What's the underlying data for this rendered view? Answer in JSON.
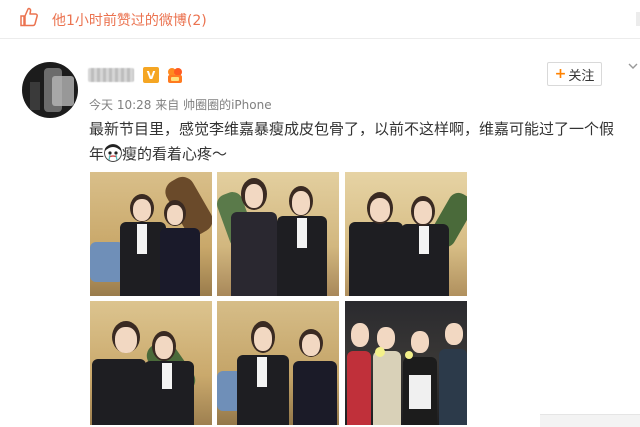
{
  "topbar": {
    "icon": "thumbs-up-icon",
    "text": "他1小时前赞过的微博(2)"
  },
  "post": {
    "avatar": "user-avatar",
    "vip_badge": "V",
    "follow_button": {
      "plus": "+",
      "label": "关注"
    },
    "meta": {
      "time": "今天 10:28",
      "source_prefix": "来自",
      "source": "帅圈圈的iPhone"
    },
    "text_line1": "最新节目里，感觉李维嘉暴瘦成皮包骨了，以前不这样啊，维嘉可能过了一个假",
    "text_line2_a": "年",
    "text_line2_b": "瘦的看着心疼～",
    "photos": [
      "photo-1",
      "photo-2",
      "photo-3",
      "photo-4",
      "photo-5",
      "photo-6"
    ]
  },
  "colors": {
    "accent": "#eb7350",
    "follow_plus": "#ff8200",
    "vip": "#f5a623",
    "meta_text": "#808080"
  }
}
